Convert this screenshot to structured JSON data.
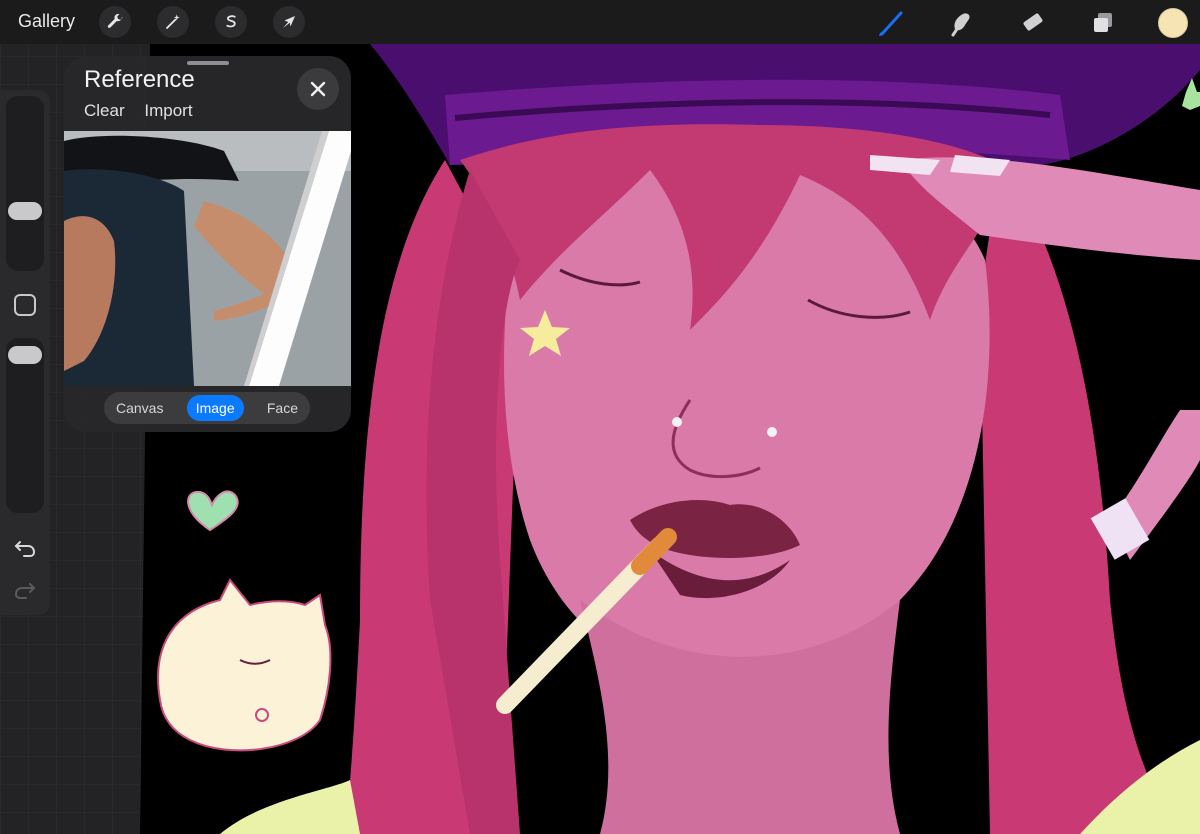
{
  "topbar": {
    "gallery_label": "Gallery",
    "left_tools": [
      "wrench-icon",
      "magic-wand-icon",
      "selection-icon",
      "transform-arrow-icon"
    ],
    "right_tools": [
      "brush-icon",
      "smudge-icon",
      "eraser-icon",
      "layers-icon"
    ],
    "active_tool": "brush",
    "accent_color": "#1c6cf5",
    "current_color": "#f6e4b5"
  },
  "sidebar": {
    "size_slider_level": 0.36,
    "opacity_slider_level": 0.92
  },
  "reference": {
    "title": "Reference",
    "clear_label": "Clear",
    "import_label": "Import",
    "modes": [
      {
        "label": "Canvas",
        "active": false
      },
      {
        "label": "Image",
        "active": true
      },
      {
        "label": "Face",
        "active": false
      }
    ]
  }
}
